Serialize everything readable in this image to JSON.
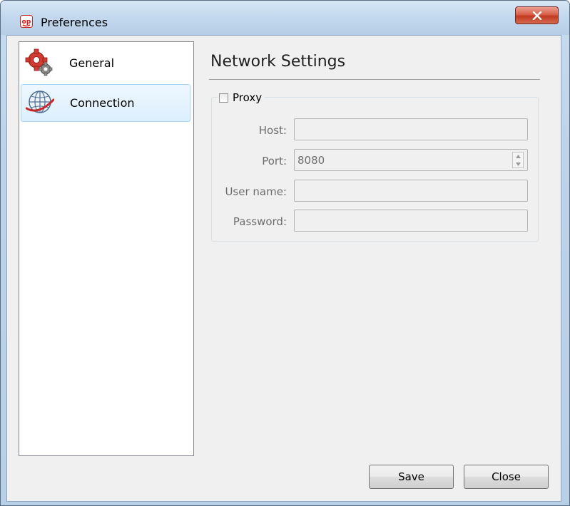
{
  "window": {
    "title": "Preferences",
    "app_icon": "op-app-icon",
    "close_icon": "close-x-icon"
  },
  "sidebar": {
    "items": [
      {
        "label": "General",
        "icon": "gear-icon",
        "selected": false
      },
      {
        "label": "Connection",
        "icon": "globe-icon",
        "selected": true
      }
    ]
  },
  "main": {
    "section_title": "Network Settings",
    "proxy_group": {
      "checkbox_label": "Proxy",
      "checked": false,
      "fields": {
        "host_label": "Host:",
        "host_value": "",
        "port_label": "Port:",
        "port_value": "8080",
        "username_label": "User name:",
        "username_value": "",
        "password_label": "Password:",
        "password_value": ""
      }
    }
  },
  "footer": {
    "save_label": "Save",
    "close_label": "Close"
  },
  "colors": {
    "selection_border": "#a9d4f5",
    "selection_fill": "#dcefff",
    "close_button": "#c13a22",
    "disabled_text": "#6d6d6d"
  }
}
